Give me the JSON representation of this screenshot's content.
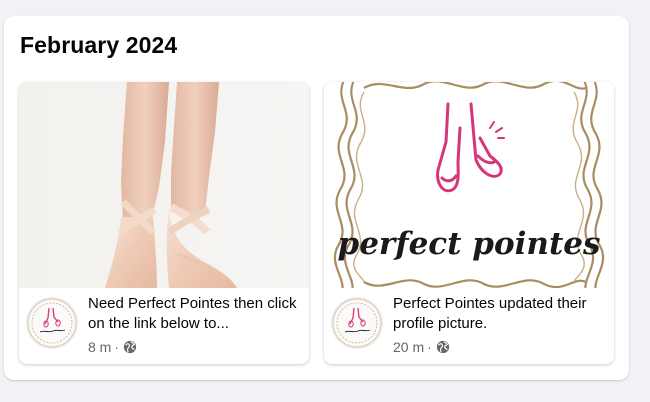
{
  "section": {
    "title": "February 2024"
  },
  "posts": [
    {
      "text": "Need Perfect Pointes then click on the link below to...",
      "time": "8 m",
      "separator": "·",
      "privacy_icon": "globe-icon",
      "media": "pointe-shoes-photo",
      "avatar": "perfect-pointes-logo"
    },
    {
      "text": "Perfect Pointes updated their profile picture.",
      "time": "20 m",
      "separator": "·",
      "privacy_icon": "globe-icon",
      "media": "perfect-pointes-logo",
      "avatar": "perfect-pointes-logo",
      "logo_text": "perfect pointes"
    }
  ],
  "colors": {
    "page_bg": "#f0f2f5",
    "card_bg": "#ffffff",
    "text_primary": "#050505",
    "text_secondary": "#65676b",
    "logo_pink": "#d6357a",
    "logo_gold": "#a88c62"
  }
}
